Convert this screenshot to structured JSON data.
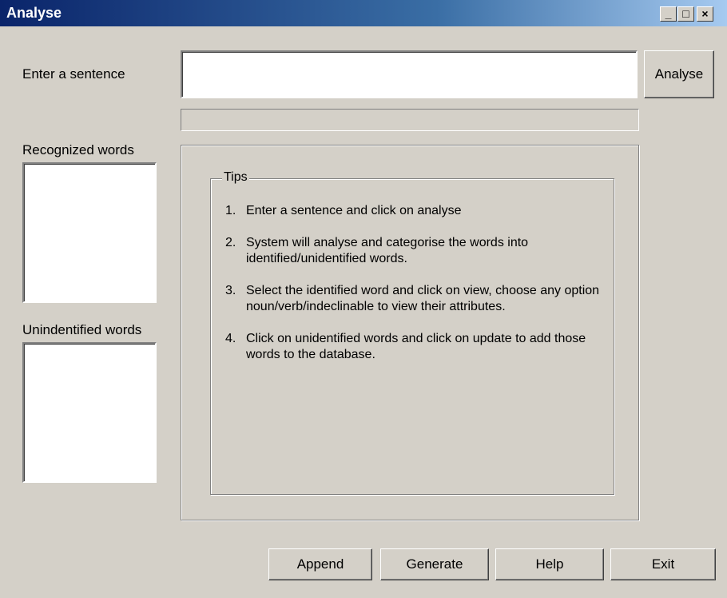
{
  "window": {
    "title": "Analyse",
    "controls": {
      "minimize": "_",
      "maximize": "□",
      "close": "×"
    }
  },
  "sentence": {
    "label": "Enter a sentence",
    "value": "",
    "analyse_button": "Analyse"
  },
  "recognized": {
    "label": "Recognized words",
    "items": []
  },
  "unidentified": {
    "label": "Unindentified words",
    "items": []
  },
  "tips": {
    "title": "Tips",
    "items": [
      {
        "num": "1.",
        "text": "Enter a sentence and click on analyse"
      },
      {
        "num": "2.",
        "text": "System will  analyse and categorise the words into identified/unidentified words."
      },
      {
        "num": "3.",
        "text": "Select  the  identified  word  and  click  on  view, choose any option noun/verb/indeclinable to view their attributes."
      },
      {
        "num": "4.",
        "text": "Click on unidentified words and click on update to add those words to the database."
      }
    ]
  },
  "buttons": {
    "append": "Append",
    "generate": "Generate",
    "help": "Help",
    "exit": "Exit"
  }
}
